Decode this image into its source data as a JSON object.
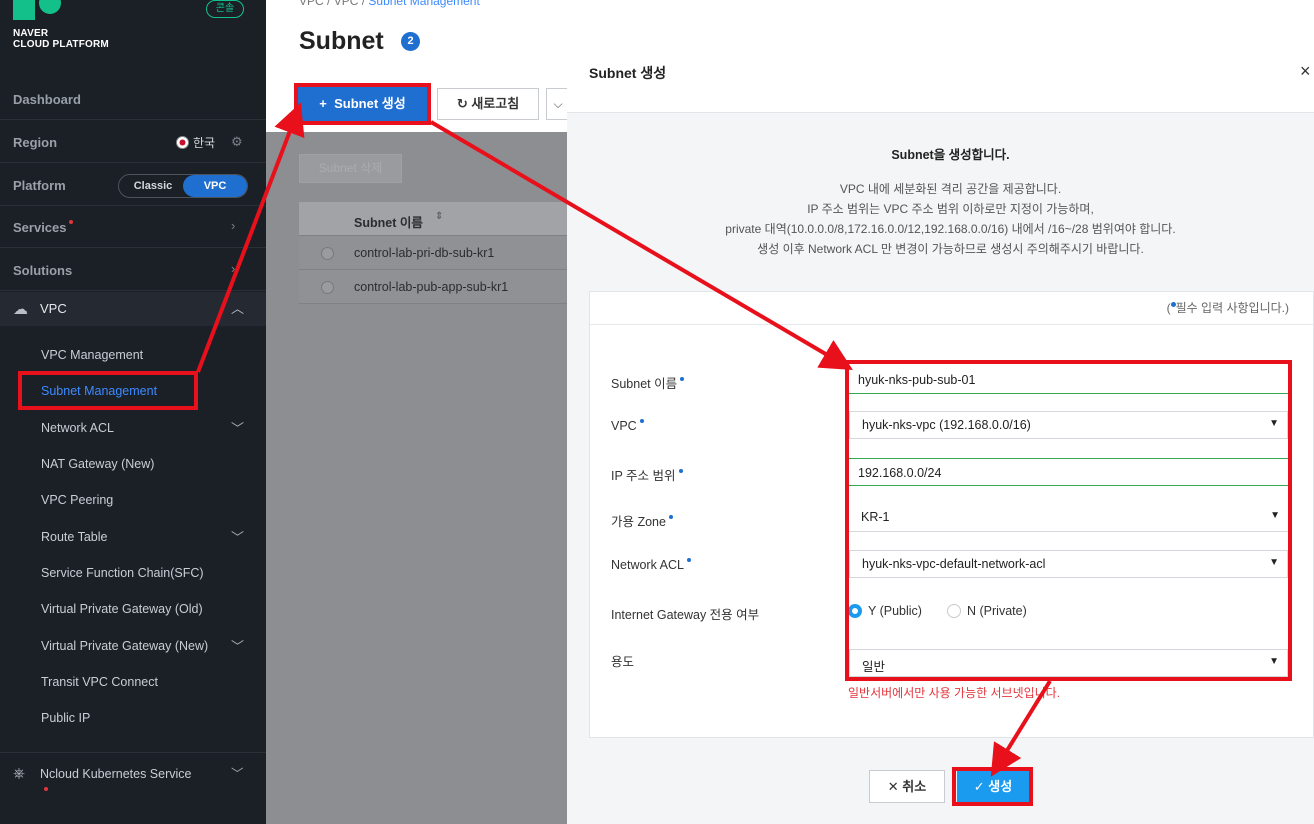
{
  "brand": {
    "line1": "NAVER",
    "line2": "CLOUD PLATFORM",
    "console_badge": "콘솔"
  },
  "sidebar": {
    "dashboard": "Dashboard",
    "region_label": "Region",
    "region_value": "한국",
    "platform_label": "Platform",
    "platform_options": [
      "Classic",
      "VPC"
    ],
    "platform_selected": "VPC",
    "services": "Services",
    "solutions": "Solutions",
    "vpc_section": "VPC",
    "vpc_items": [
      "VPC Management",
      "Subnet Management",
      "Network ACL",
      "NAT Gateway (New)",
      "VPC Peering",
      "Route Table",
      "Service Function Chain(SFC)",
      "Virtual Private Gateway (Old)",
      "Virtual Private Gateway (New)",
      "Transit VPC Connect",
      "Public IP"
    ],
    "active_item": "Subnet Management",
    "nks_section": "Ncloud Kubernetes Service"
  },
  "page": {
    "breadcrumb": {
      "a": "VPC",
      "b": "VPC",
      "current": "Subnet Management"
    },
    "title": "Subnet",
    "count": "2",
    "create_button": "Subnet 생성",
    "refresh_button": "새로고침",
    "delete_button": "Subnet 삭제",
    "table": {
      "column": "Subnet 이름",
      "rows": [
        "control-lab-pri-db-sub-kr1",
        "control-lab-pub-app-sub-kr1"
      ]
    }
  },
  "modal": {
    "title": "Subnet 생성",
    "intro_title": "Subnet을 생성합니다.",
    "intro_lines": [
      "VPC 내에 세분화된 격리 공간을 제공합니다.",
      "IP 주소 범위는 VPC 주소 범위 이하로만 지정이 가능하며,",
      "private 대역(10.0.0.0/8,172.16.0.0/12,192.168.0.0/16) 내에서 /16~/28 범위여야 합니다.",
      "생성 이후 Network ACL 만 변경이 가능하므로 생성시 주의해주시기 바랍니다."
    ],
    "required_note": "필수 입력 사항입니다.",
    "fields": {
      "subnet_name": {
        "label": "Subnet 이름",
        "value": "hyuk-nks-pub-sub-01"
      },
      "vpc": {
        "label": "VPC",
        "value": "hyuk-nks-vpc (192.168.0.0/16)"
      },
      "ip_range": {
        "label": "IP 주소 범위",
        "value": "192.168.0.0/24"
      },
      "zone": {
        "label": "가용 Zone",
        "value": "KR-1"
      },
      "network_acl": {
        "label": "Network ACL",
        "value": "hyuk-nks-vpc-default-network-acl"
      },
      "igw": {
        "label": "Internet Gateway 전용 여부",
        "options": [
          "Y (Public)",
          "N (Private)"
        ],
        "selected": "Y (Public)"
      },
      "usage": {
        "label": "용도",
        "value": "일반",
        "help": "일반서버에서만 사용 가능한 서브넷입니다."
      }
    },
    "cancel_button": "취소",
    "create_button": "생성"
  },
  "colors": {
    "accent": "#1f6fd0",
    "confirm": "#1a9bf0",
    "annotation": "#e8101a",
    "sidebar_bg": "#1b1f26"
  }
}
